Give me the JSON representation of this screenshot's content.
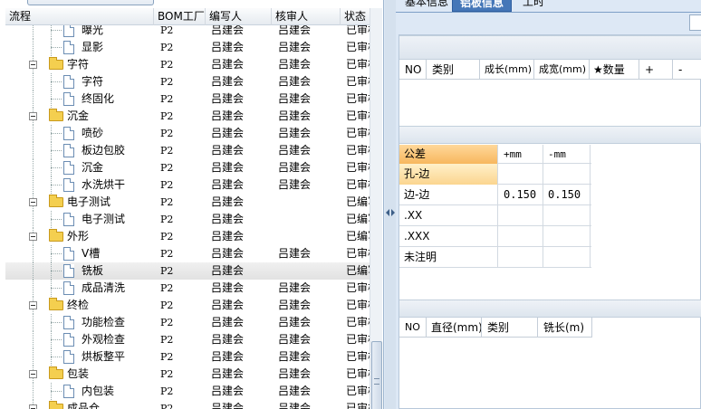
{
  "tree": {
    "columns": {
      "process": "流程",
      "bom": "BOM工厂",
      "writer": "编写人",
      "reviewer": "核审人",
      "status": "状态"
    },
    "rows": [
      {
        "type": "leaf",
        "label": "曝光",
        "bom": "P2",
        "writer": "吕建会",
        "reviewer": "吕建会",
        "status": "已审核"
      },
      {
        "type": "leaf",
        "label": "显影",
        "bom": "P2",
        "writer": "吕建会",
        "reviewer": "吕建会",
        "status": "已审核"
      },
      {
        "type": "folder",
        "label": "字符",
        "bom": "P2",
        "writer": "吕建会",
        "reviewer": "吕建会",
        "status": "已审核"
      },
      {
        "type": "leaf",
        "label": "字符",
        "bom": "P2",
        "writer": "吕建会",
        "reviewer": "吕建会",
        "status": "已审核"
      },
      {
        "type": "leaf",
        "label": "终固化",
        "bom": "P2",
        "writer": "吕建会",
        "reviewer": "吕建会",
        "status": "已审核"
      },
      {
        "type": "folder",
        "label": "沉金",
        "bom": "P2",
        "writer": "吕建会",
        "reviewer": "吕建会",
        "status": "已审核"
      },
      {
        "type": "leaf",
        "label": "喷砂",
        "bom": "P2",
        "writer": "吕建会",
        "reviewer": "吕建会",
        "status": "已审核"
      },
      {
        "type": "leaf",
        "label": "板边包胶",
        "bom": "P2",
        "writer": "吕建会",
        "reviewer": "吕建会",
        "status": "已审核"
      },
      {
        "type": "leaf",
        "label": "沉金",
        "bom": "P2",
        "writer": "吕建会",
        "reviewer": "吕建会",
        "status": "已审核"
      },
      {
        "type": "leaf",
        "label": "水洗烘干",
        "bom": "P2",
        "writer": "吕建会",
        "reviewer": "吕建会",
        "status": "已审核"
      },
      {
        "type": "folder",
        "label": "电子测试",
        "bom": "P2",
        "writer": "吕建会",
        "reviewer": "",
        "status": "已编写"
      },
      {
        "type": "leaf",
        "label": "电子测试",
        "bom": "P2",
        "writer": "吕建会",
        "reviewer": "",
        "status": "已编写"
      },
      {
        "type": "folder",
        "label": "外形",
        "bom": "P2",
        "writer": "吕建会",
        "reviewer": "",
        "status": "已编写"
      },
      {
        "type": "leaf",
        "label": "V槽",
        "bom": "P2",
        "writer": "吕建会",
        "reviewer": "吕建会",
        "status": "已审核"
      },
      {
        "type": "leaf",
        "label": "铣板",
        "bom": "P2",
        "writer": "吕建会",
        "reviewer": "",
        "status": "已编写",
        "selected": true
      },
      {
        "type": "leaf",
        "label": "成品清洗",
        "bom": "P2",
        "writer": "吕建会",
        "reviewer": "吕建会",
        "status": "已审核"
      },
      {
        "type": "folder",
        "label": "终检",
        "bom": "P2",
        "writer": "吕建会",
        "reviewer": "吕建会",
        "status": "已审核"
      },
      {
        "type": "leaf",
        "label": "功能检查",
        "bom": "P2",
        "writer": "吕建会",
        "reviewer": "吕建会",
        "status": "已审核"
      },
      {
        "type": "leaf",
        "label": "外观检查",
        "bom": "P2",
        "writer": "吕建会",
        "reviewer": "吕建会",
        "status": "已审核"
      },
      {
        "type": "leaf",
        "label": "烘板整平",
        "bom": "P2",
        "writer": "吕建会",
        "reviewer": "吕建会",
        "status": "已审核"
      },
      {
        "type": "folder",
        "label": "包装",
        "bom": "P2",
        "writer": "吕建会",
        "reviewer": "吕建会",
        "status": "已审核"
      },
      {
        "type": "leaf",
        "label": "内包装",
        "bom": "P2",
        "writer": "吕建会",
        "reviewer": "吕建会",
        "status": "已审核"
      },
      {
        "type": "folder",
        "label": "成品仓",
        "bom": "P2",
        "writer": "吕建会",
        "reviewer": "吕建会",
        "status": "已审核"
      }
    ]
  },
  "tabs": {
    "basic_info": "基本信息",
    "process_info": "铝板信息",
    "tools": "工时"
  },
  "grid1": {
    "headers": [
      "NO",
      "类别",
      "成长(mm)",
      "成宽(mm)",
      "★数量",
      "+",
      "-"
    ]
  },
  "tolerance": {
    "headers": [
      "公差",
      "+mm",
      "-mm"
    ],
    "rows": [
      {
        "name": "孔-边",
        "plus": "",
        "minus": ""
      },
      {
        "name": "边-边",
        "plus": "0.150",
        "minus": "0.150"
      },
      {
        "name": ".XX",
        "plus": "",
        "minus": ""
      },
      {
        "name": ".XXX",
        "plus": "",
        "minus": ""
      },
      {
        "name": "未注明",
        "plus": "",
        "minus": ""
      }
    ]
  },
  "grid2": {
    "headers": [
      "NO",
      "直径(mm)",
      "类别",
      "铣长(m)"
    ]
  },
  "colors": {
    "tab_active": "#4577b8",
    "highlight": "#f7b75e",
    "panel_bg": "#dde8f5"
  }
}
